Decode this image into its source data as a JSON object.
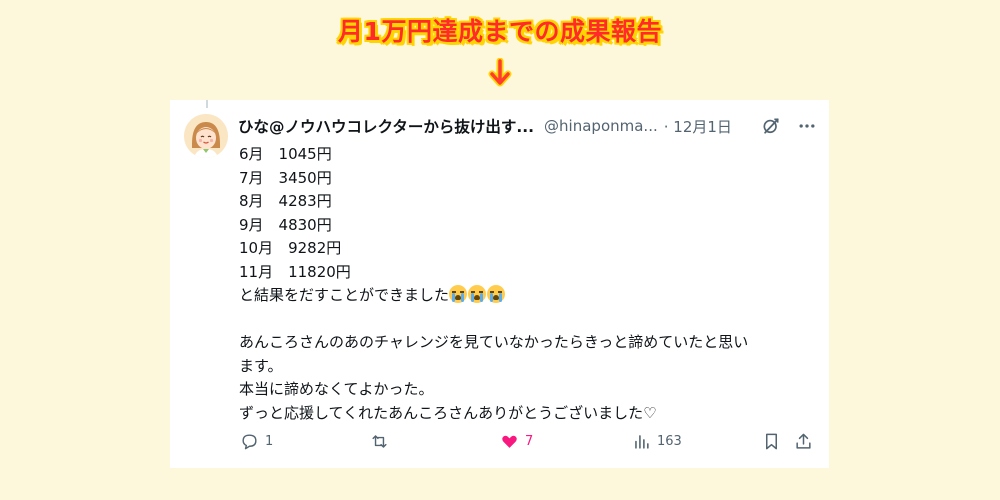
{
  "headline": "月1万円達成までの成果報告",
  "tweet": {
    "display_name": "ひな@ノウハウコレクターから抜け出す...",
    "handle": "@hinaponma...",
    "date": "· 12月1日",
    "lines": [
      "6月　1045円",
      "7月　3450円",
      "8月　4283円",
      "9月　4830円",
      "10月　9282円",
      "11月　11820円",
      "と結果をだすことができました",
      "",
      "あんころさんのあのチャレンジを見ていなかったらきっと諦めていたと思い",
      "ます。",
      "本当に諦めなくてよかった。",
      "ずっと応援してくれたあんころさんありがとうございました♡"
    ],
    "emoji_name": "loudly-crying-face-emoji",
    "stats": {
      "replies": "1",
      "reposts": "",
      "likes": "7",
      "views": "163"
    }
  },
  "colors": {
    "background": "#fdf7dc",
    "headline_text": "#ff2a2a",
    "headline_outline": "#ffd400",
    "arrow": "#ff3b30",
    "like": "#f91880",
    "muted": "#536471"
  }
}
